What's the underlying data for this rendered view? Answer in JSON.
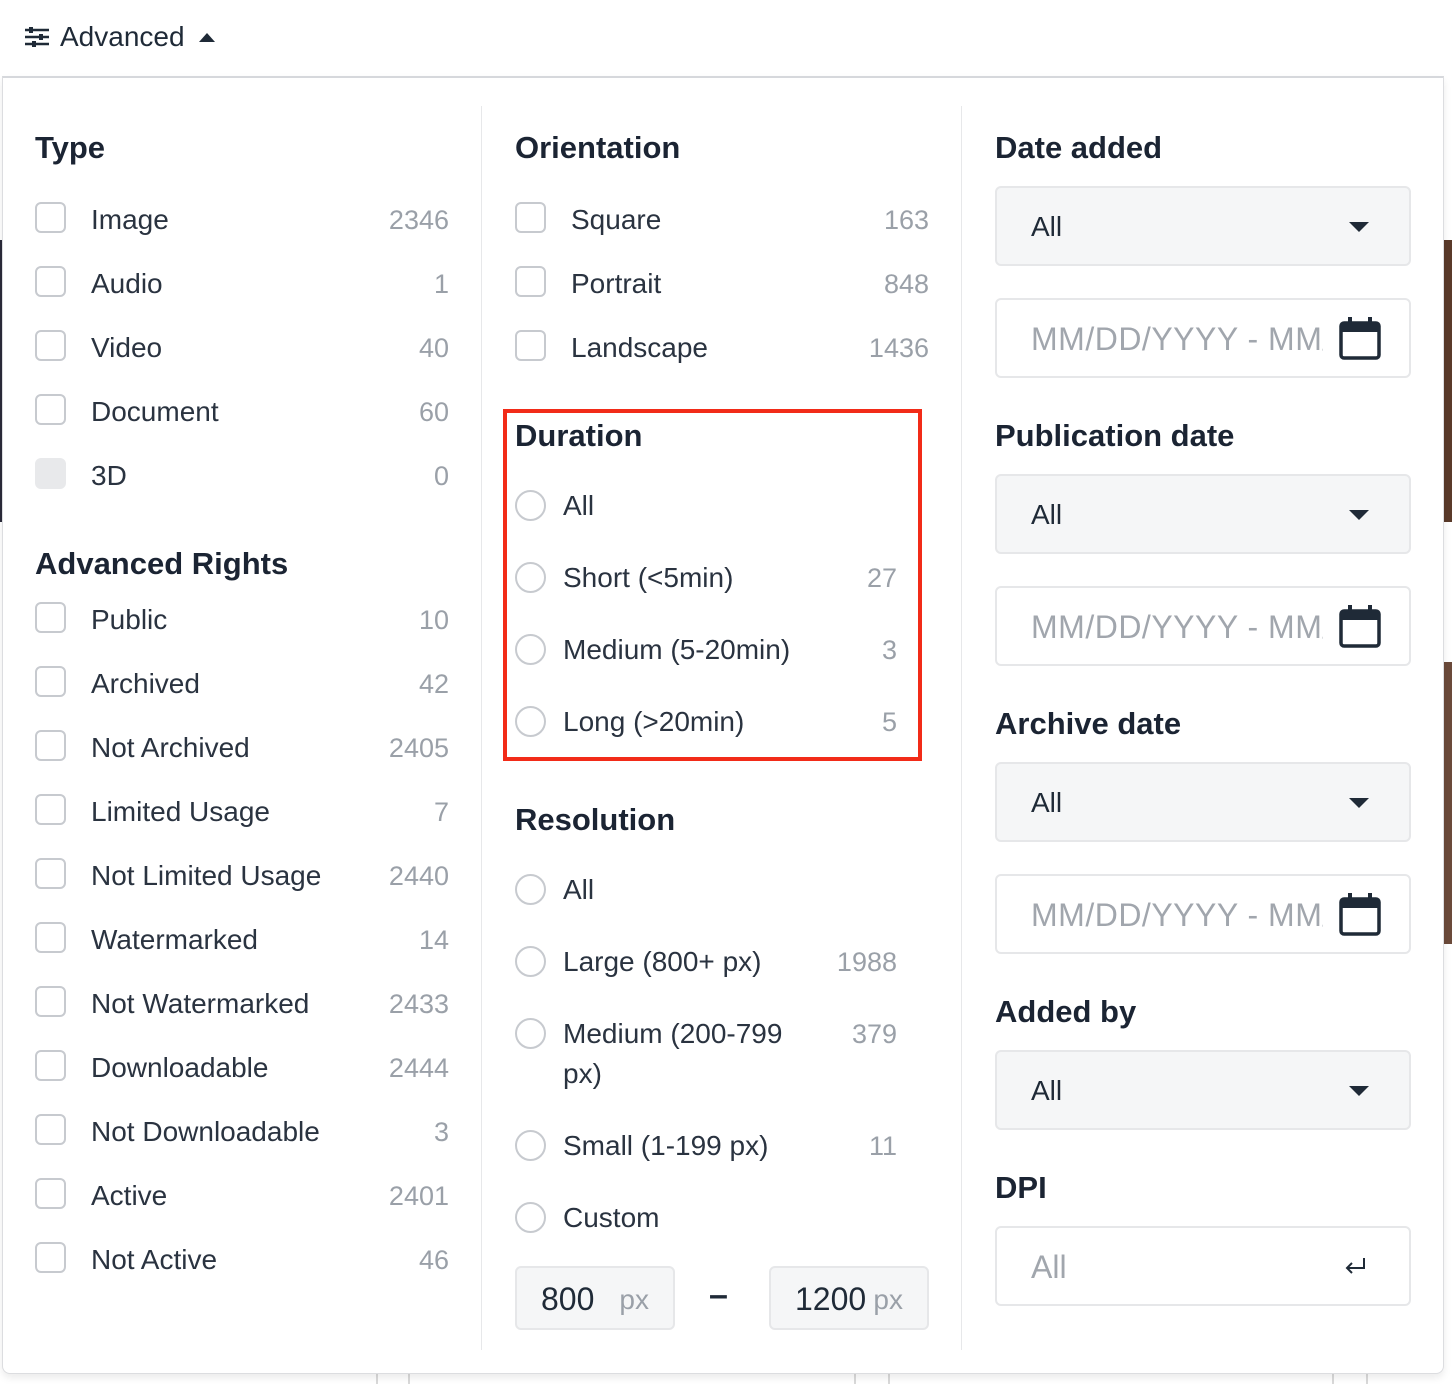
{
  "header": {
    "advanced_label": "Advanced"
  },
  "type": {
    "title": "Type",
    "items": [
      {
        "label": "Image",
        "count": "2346"
      },
      {
        "label": "Audio",
        "count": "1"
      },
      {
        "label": "Video",
        "count": "40"
      },
      {
        "label": "Document",
        "count": "60"
      },
      {
        "label": "3D",
        "count": "0"
      }
    ]
  },
  "rights": {
    "title": "Advanced Rights",
    "items": [
      {
        "label": "Public",
        "count": "10"
      },
      {
        "label": "Archived",
        "count": "42"
      },
      {
        "label": "Not Archived",
        "count": "2405"
      },
      {
        "label": "Limited Usage",
        "count": "7"
      },
      {
        "label": "Not Limited Usage",
        "count": "2440"
      },
      {
        "label": "Watermarked",
        "count": "14"
      },
      {
        "label": "Not Watermarked",
        "count": "2433"
      },
      {
        "label": "Downloadable",
        "count": "2444"
      },
      {
        "label": "Not Downloadable",
        "count": "3"
      },
      {
        "label": "Active",
        "count": "2401"
      },
      {
        "label": "Not Active",
        "count": "46"
      }
    ]
  },
  "orientation": {
    "title": "Orientation",
    "items": [
      {
        "label": "Square",
        "count": "163"
      },
      {
        "label": "Portrait",
        "count": "848"
      },
      {
        "label": "Landscape",
        "count": "1436"
      }
    ]
  },
  "duration": {
    "title": "Duration",
    "items": [
      {
        "label": "All",
        "count": ""
      },
      {
        "label": "Short (<5min)",
        "count": "27"
      },
      {
        "label": "Medium (5-20min)",
        "count": "3"
      },
      {
        "label": "Long (>20min)",
        "count": "5"
      }
    ]
  },
  "resolution": {
    "title": "Resolution",
    "items": [
      {
        "label": "All",
        "count": ""
      },
      {
        "label": "Large (800+ px)",
        "count": "1988"
      },
      {
        "label_line1": "Medium (200-799",
        "label_line2": "px)",
        "count": "379"
      },
      {
        "label": "Small (1-199 px)",
        "count": "11"
      },
      {
        "label": "Custom",
        "count": ""
      }
    ],
    "min_value": "800",
    "max_value": "1200",
    "unit": "px",
    "separator": "–"
  },
  "date_added": {
    "title": "Date added",
    "select_value": "All",
    "range_placeholder": "MM/DD/YYYY - MM/DD/YYYY"
  },
  "publication_date": {
    "title": "Publication date",
    "select_value": "All",
    "range_placeholder": "MM/DD/YYYY - MM/DD/YYYY"
  },
  "archive_date": {
    "title": "Archive date",
    "select_value": "All",
    "range_placeholder": "MM/DD/YYYY - MM/DD/YYYY"
  },
  "added_by": {
    "title": "Added by",
    "select_value": "All"
  },
  "dpi": {
    "title": "DPI",
    "placeholder": "All"
  },
  "colors": {
    "highlight": "#f22b18",
    "text": "#1f2a37",
    "muted": "#9aa0a8",
    "border": "#c7cacf"
  },
  "icons": {
    "filter": "sliders-icon",
    "calendar": "calendar-icon",
    "enter": "enter-key-icon"
  }
}
